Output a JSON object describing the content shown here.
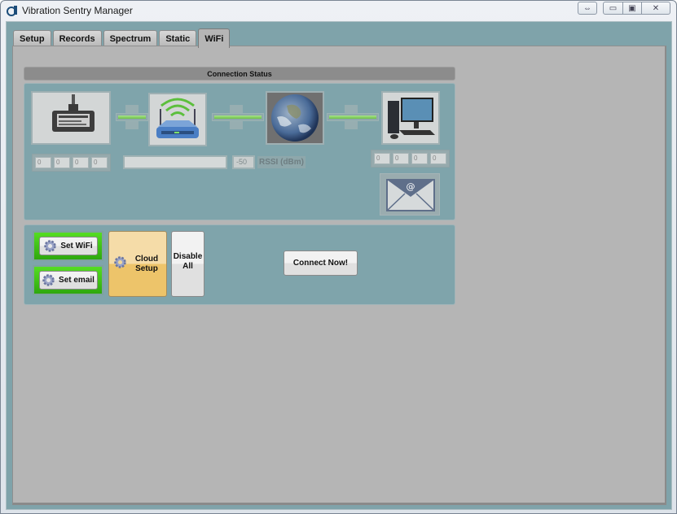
{
  "window": {
    "title": "Vibration Sentry Manager",
    "controls": {
      "resize": "⇔",
      "minimize": "▭",
      "maximize": "▣",
      "close": "✕"
    }
  },
  "tabs": [
    {
      "label": "Setup",
      "active": false
    },
    {
      "label": "Records",
      "active": false
    },
    {
      "label": "Spectrum",
      "active": false
    },
    {
      "label": "Static",
      "active": false
    },
    {
      "label": "WiFi",
      "active": true
    }
  ],
  "connection_status": {
    "header": "Connection Status",
    "nodes": [
      {
        "name": "sensor-device",
        "icon": "sensor-image"
      },
      {
        "name": "wifi-router",
        "icon": "router-image"
      },
      {
        "name": "internet",
        "icon": "earth-image"
      },
      {
        "name": "computer",
        "icon": "computer-image"
      }
    ],
    "links_active": [
      true,
      true,
      true
    ],
    "device_ip": [
      "0",
      "0",
      "0",
      "0"
    ],
    "ssid_value": "",
    "rssi_value": "-50",
    "rssi_label": "RSSI (dBm)",
    "computer_ip": [
      "0",
      "0",
      "0",
      "0"
    ],
    "email_icon": "email-envelope-icon"
  },
  "actions": {
    "set_wifi": "Set WiFi",
    "set_email": "Set email",
    "cloud_setup": "Cloud Setup",
    "disable_all": "Disable All",
    "connect_now": "Connect Now!"
  },
  "colors": {
    "client_bg": "#7fa3aa",
    "page_bg": "#b5b5b5",
    "link_green": "#6fc148",
    "set_button_glow": "#3cbf14",
    "cloud_button": "#edc46a"
  }
}
